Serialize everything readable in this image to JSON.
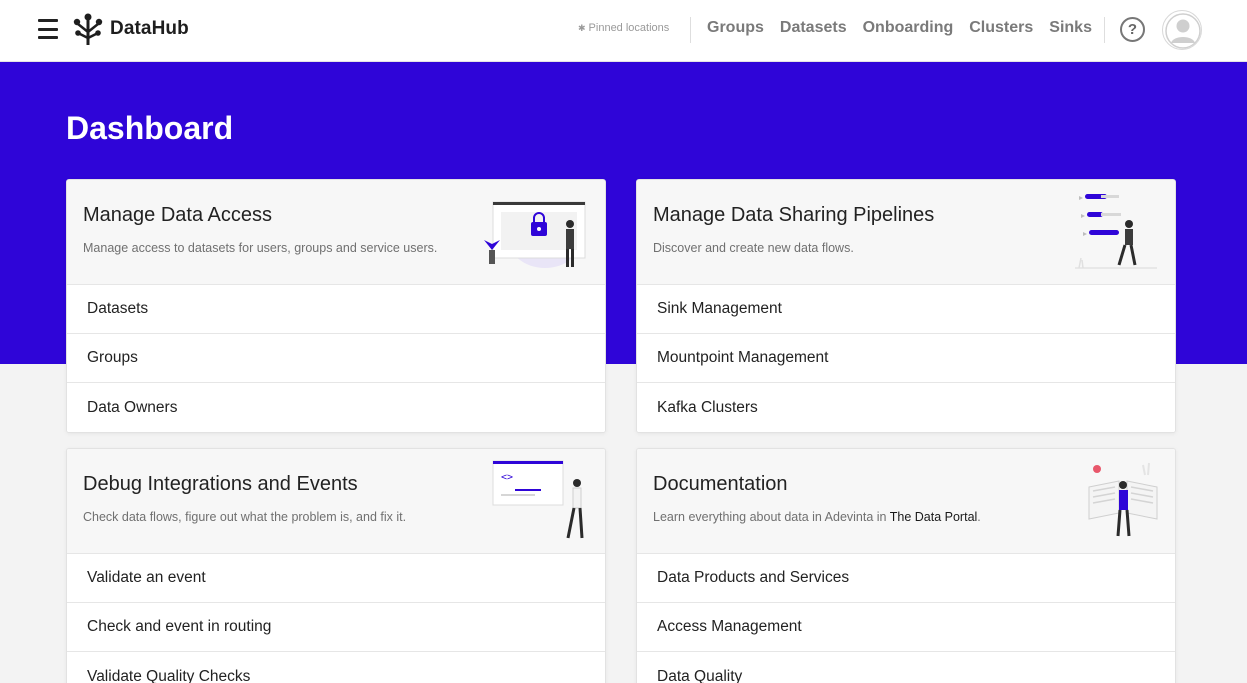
{
  "header": {
    "brand": "DataHub",
    "pinned": "Pinned locations",
    "nav": [
      "Groups",
      "Datasets",
      "Onboarding",
      "Clusters",
      "Sinks"
    ],
    "help": "?"
  },
  "page": {
    "title": "Dashboard"
  },
  "cards": [
    {
      "title": "Manage Data Access",
      "description": "Manage access to datasets for users, groups and service users.",
      "items": [
        "Datasets",
        "Groups",
        "Data Owners"
      ]
    },
    {
      "title": "Manage Data Sharing Pipelines",
      "description": "Discover and create new data flows.",
      "items": [
        "Sink Management",
        "Mountpoint Management",
        "Kafka Clusters"
      ]
    },
    {
      "title": "Debug Integrations and Events",
      "description": "Check data flows, figure out what the problem is, and fix it.",
      "items": [
        "Validate an event",
        "Check and event in routing",
        "Validate Quality Checks"
      ]
    },
    {
      "title": "Documentation",
      "description_prefix": "Learn everything about data in Adevinta in ",
      "description_link": "The Data Portal",
      "description_suffix": ".",
      "items": [
        "Data Products and Services",
        "Access Management",
        "Data Quality"
      ]
    }
  ],
  "colors": {
    "accent": "#2f05d8",
    "background": "#f3f3f3"
  }
}
